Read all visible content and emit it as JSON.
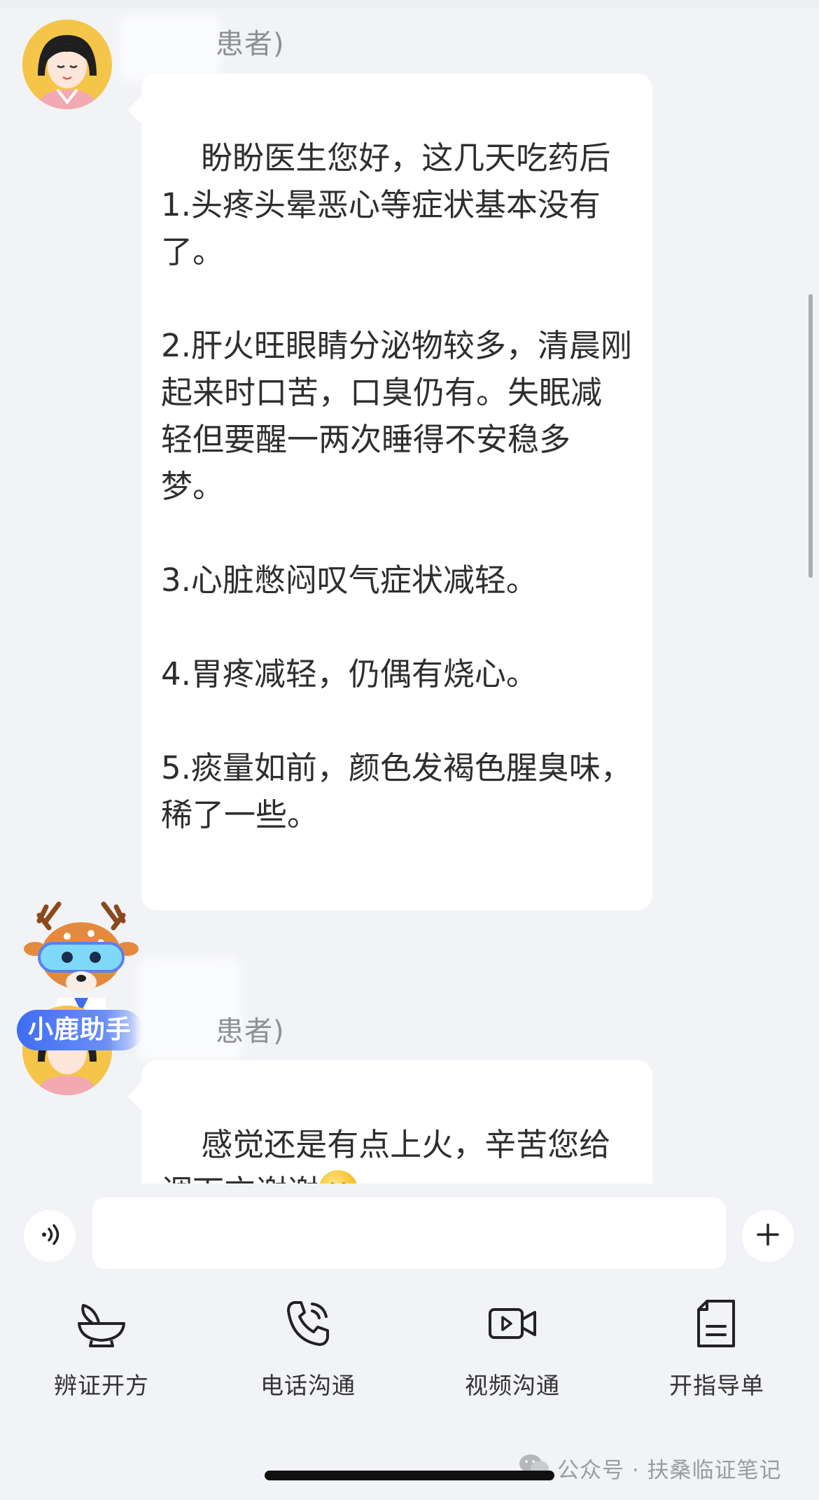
{
  "messages": [
    {
      "sender_visible": "患者)",
      "text": "盼盼医生您好，这几天吃药后\n1.头疼头晕恶心等症状基本没有了。\n\n2.肝火旺眼睛分泌物较多，清晨刚起来时口苦，口臭仍有。失眠减轻但要醒一两次睡得不安稳多梦。\n\n3.心脏憋闷叹气症状减轻。\n\n4.胃疼减轻，仍偶有烧心。\n\n5.痰量如前，颜色发褐色腥臭味，稀了一些。\n\n"
    },
    {
      "sender_visible": "患者)",
      "text": "感觉还是有点上火，辛苦您给调下方谢谢",
      "emoji": "smiling-face-icon"
    }
  ],
  "assistant": {
    "badge": "小鹿助手"
  },
  "composer": {
    "placeholder": "",
    "value": ""
  },
  "actions": [
    {
      "label": "辨证开方",
      "icon": "herb-bowl-icon"
    },
    {
      "label": "电话沟通",
      "icon": "phone-icon"
    },
    {
      "label": "视频沟通",
      "icon": "video-camera-icon"
    },
    {
      "label": "开指导单",
      "icon": "document-icon"
    }
  ],
  "watermark": "公众号 · 扶桑临证笔记",
  "colors": {
    "background": "#f2f3f6",
    "bubble": "#ffffff",
    "avatar": "#f5c54a",
    "badge": "#3f6cf2"
  }
}
